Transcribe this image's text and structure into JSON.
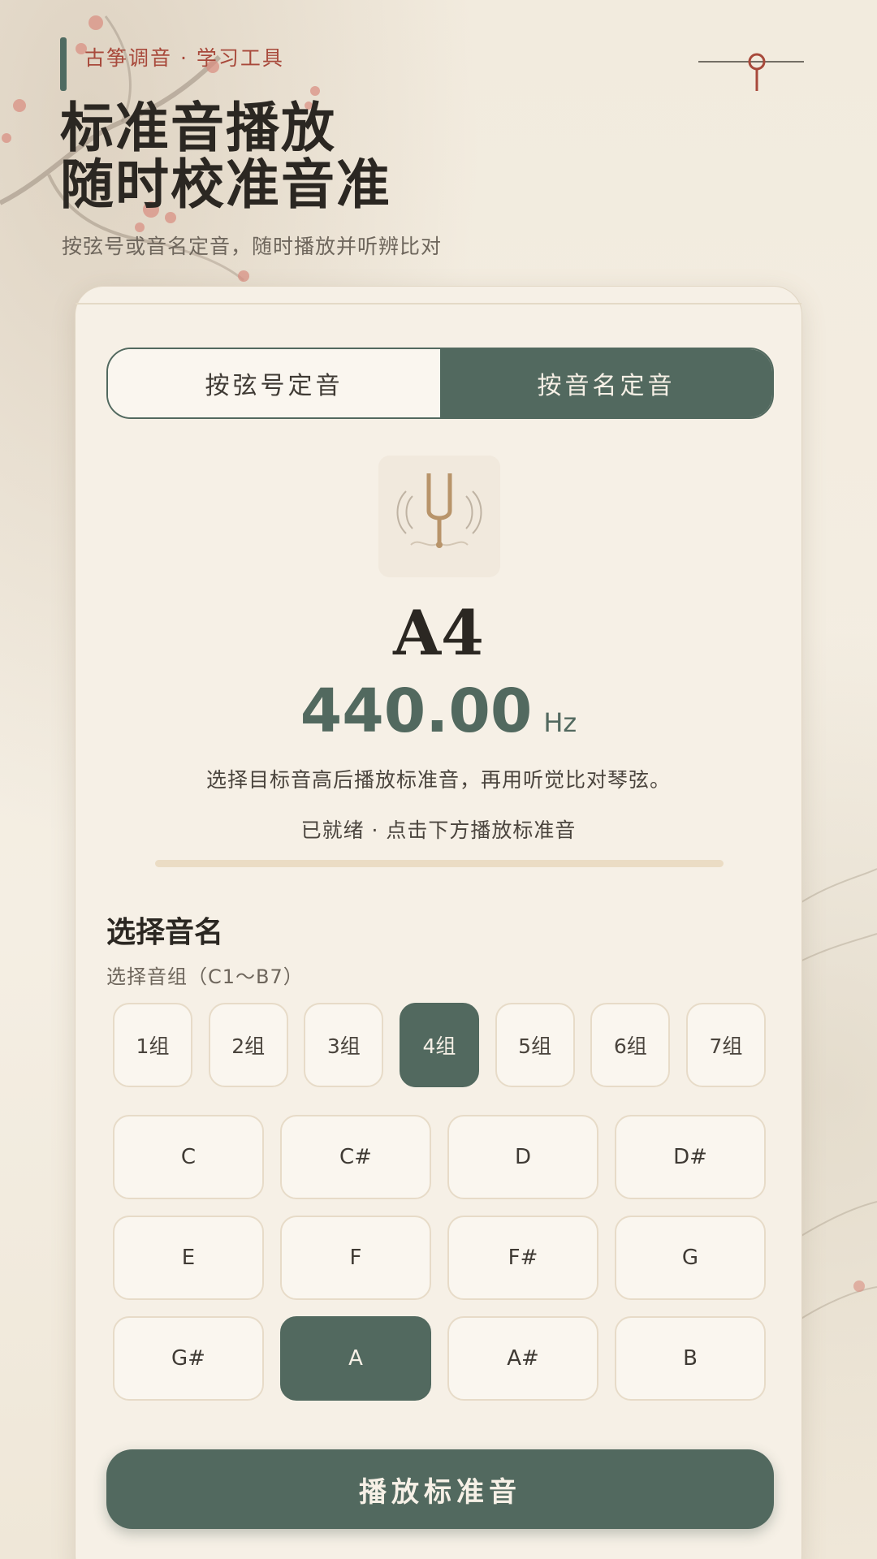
{
  "header": {
    "tag": "古筝调音 · 学习工具",
    "title_line1": "标准音播放",
    "title_line2": "随时校准音准",
    "subtitle": "按弦号或音名定音，随时播放并听辨比对"
  },
  "mode_tabs": [
    {
      "label": "按弦号定音",
      "active": false
    },
    {
      "label": "按音名定音",
      "active": true
    }
  ],
  "tuner": {
    "icon": "tuning-fork-icon",
    "note": "A4",
    "frequency": "440.00",
    "unit": "Hz",
    "hint": "选择目标音高后播放标准音，再用听觉比对琴弦。",
    "status": "已就绪 · 点击下方播放标准音",
    "progress": 0
  },
  "selector": {
    "title": "选择音名",
    "octave_label": "选择音组（C1～B7）",
    "octaves": [
      "1组",
      "2组",
      "3组",
      "4组",
      "5组",
      "6组",
      "7组"
    ],
    "selected_octave": "4组",
    "notes": [
      "C",
      "C#",
      "D",
      "D#",
      "E",
      "F",
      "F#",
      "G",
      "G#",
      "A",
      "A#",
      "B"
    ],
    "selected_note": "A"
  },
  "play_button": "播放标准音",
  "colors": {
    "accent": "#52695f",
    "tag": "#a8493b",
    "background": "#f3ecdf",
    "card": "#f6f0e6"
  }
}
